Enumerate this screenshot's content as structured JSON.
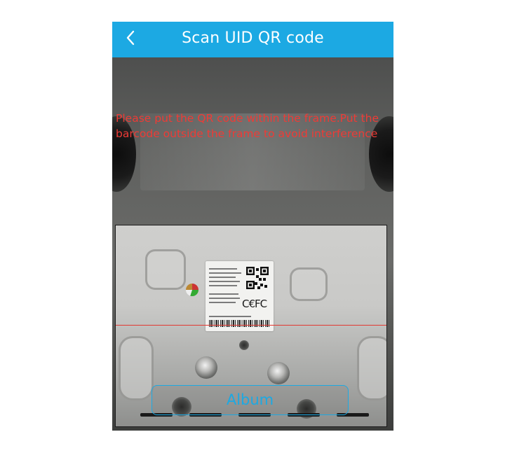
{
  "header": {
    "title": "Scan UID QR code",
    "back_icon": "chevron-left-icon",
    "color": "#1ca9e3"
  },
  "hint": {
    "text": "Please put the QR code within the frame.Put the barcode outside the frame to avoid interference",
    "color": "#ee3b36"
  },
  "album": {
    "label": "Album"
  }
}
